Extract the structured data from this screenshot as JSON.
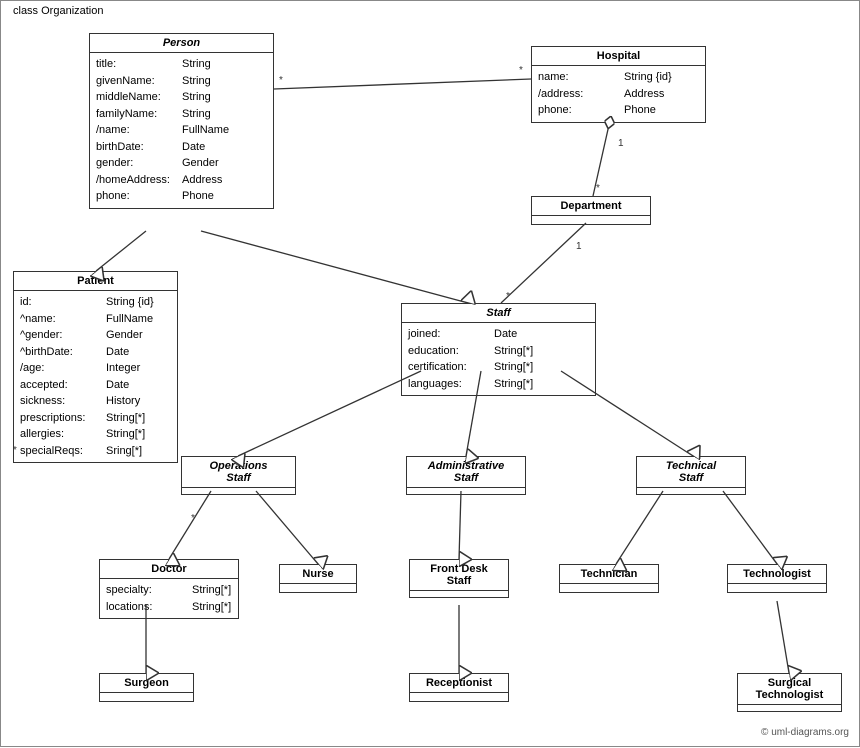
{
  "diagram_title": "class Organization",
  "classes": {
    "person": {
      "name": "Person",
      "italic": true,
      "attrs": [
        {
          "name": "title:",
          "type": "String"
        },
        {
          "name": "givenName:",
          "type": "String"
        },
        {
          "name": "middleName:",
          "type": "String"
        },
        {
          "name": "familyName:",
          "type": "String"
        },
        {
          "name": "/name:",
          "type": "FullName"
        },
        {
          "name": "birthDate:",
          "type": "Date"
        },
        {
          "name": "gender:",
          "type": "Gender"
        },
        {
          "name": "/homeAddress:",
          "type": "Address"
        },
        {
          "name": "phone:",
          "type": "Phone"
        }
      ]
    },
    "hospital": {
      "name": "Hospital",
      "italic": false,
      "attrs": [
        {
          "name": "name:",
          "type": "String {id}"
        },
        {
          "name": "/address:",
          "type": "Address"
        },
        {
          "name": "phone:",
          "type": "Phone"
        }
      ]
    },
    "patient": {
      "name": "Patient",
      "italic": false,
      "attrs": [
        {
          "name": "id:",
          "type": "String {id}"
        },
        {
          "name": "^name:",
          "type": "FullName"
        },
        {
          "name": "^gender:",
          "type": "Gender"
        },
        {
          "name": "^birthDate:",
          "type": "Date"
        },
        {
          "name": "/age:",
          "type": "Integer"
        },
        {
          "name": "accepted:",
          "type": "Date"
        },
        {
          "name": "sickness:",
          "type": "History"
        },
        {
          "name": "prescriptions:",
          "type": "String[*]"
        },
        {
          "name": "allergies:",
          "type": "String[*]"
        },
        {
          "name": "specialReqs:",
          "type": "Sring[*]"
        }
      ]
    },
    "department": {
      "name": "Department",
      "italic": false,
      "attrs": []
    },
    "staff": {
      "name": "Staff",
      "italic": true,
      "attrs": [
        {
          "name": "joined:",
          "type": "Date"
        },
        {
          "name": "education:",
          "type": "String[*]"
        },
        {
          "name": "certification:",
          "type": "String[*]"
        },
        {
          "name": "languages:",
          "type": "String[*]"
        }
      ]
    },
    "operations_staff": {
      "name": "Operations Staff",
      "italic": true,
      "attrs": []
    },
    "administrative_staff": {
      "name": "Administrative Staff",
      "italic": true,
      "attrs": []
    },
    "technical_staff": {
      "name": "Technical Staff",
      "italic": true,
      "attrs": []
    },
    "doctor": {
      "name": "Doctor",
      "italic": false,
      "attrs": [
        {
          "name": "specialty:",
          "type": "String[*]"
        },
        {
          "name": "locations:",
          "type": "String[*]"
        }
      ]
    },
    "nurse": {
      "name": "Nurse",
      "italic": false,
      "attrs": []
    },
    "front_desk_staff": {
      "name": "Front Desk Staff",
      "italic": false,
      "attrs": []
    },
    "technician": {
      "name": "Technician",
      "italic": false,
      "attrs": []
    },
    "technologist": {
      "name": "Technologist",
      "italic": false,
      "attrs": []
    },
    "surgeon": {
      "name": "Surgeon",
      "italic": false,
      "attrs": []
    },
    "receptionist": {
      "name": "Receptionist",
      "italic": false,
      "attrs": []
    },
    "surgical_technologist": {
      "name": "Surgical Technologist",
      "italic": false,
      "attrs": []
    }
  },
  "copyright": "© uml-diagrams.org"
}
